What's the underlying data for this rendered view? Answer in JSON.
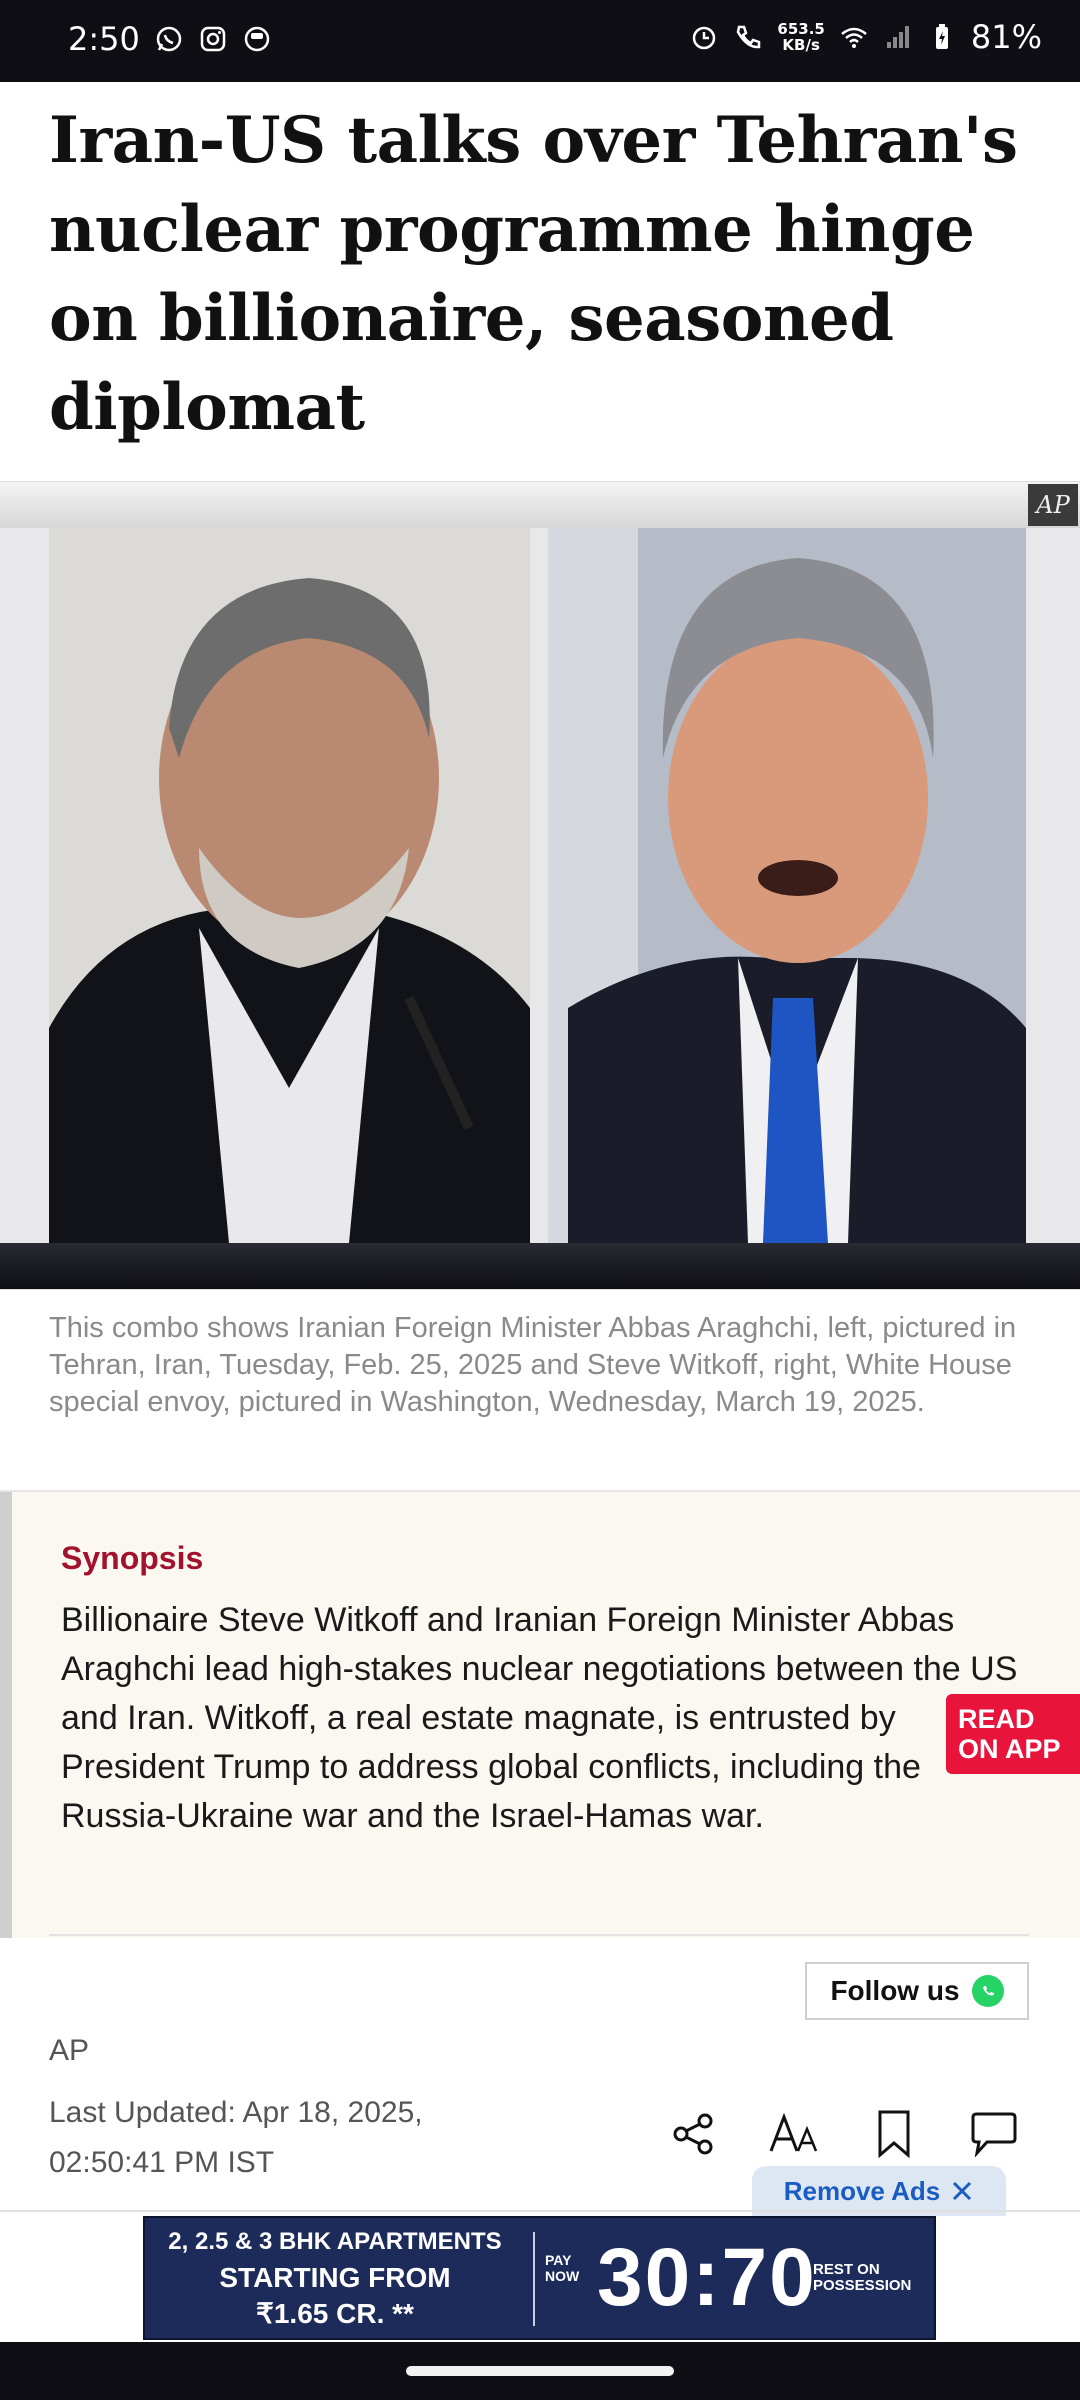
{
  "status_bar": {
    "time": "2:50",
    "speed_value": "653.5",
    "speed_unit": "KB/s",
    "battery": "81%"
  },
  "article": {
    "headline": "Iran-US talks over Tehran's nuclear programme hinge on billionaire, seasoned diplomat",
    "image_credit": "AP",
    "caption": "This combo shows Iranian Foreign Minister Abbas Araghchi, left, pictured in Tehran, Iran, Tuesday, Feb. 25, 2025 and Steve Witkoff, right, White House special envoy, pictured in Washington, Wednesday, March 19, 2025.",
    "synopsis_title": "Synopsis",
    "synopsis_text": "Billionaire Steve Witkoff and Iranian Foreign Minister Abbas Araghchi lead high-stakes nuclear negotiations between the US and Iran. Witkoff, a real estate magnate, is entrusted by President Trump to address global conflicts, including the Russia-Ukraine war and the Israel-Hamas war.",
    "source": "AP",
    "last_updated_line1": "Last Updated: Apr 18, 2025,",
    "last_updated_line2": "02:50:41 PM IST"
  },
  "buttons": {
    "read_on_app_line1": "READ",
    "read_on_app_line2": "ON APP",
    "follow_us": "Follow us",
    "remove_ads": "Remove Ads"
  },
  "ad": {
    "line1": "2, 2.5 & 3 BHK APARTMENTS",
    "line2": "STARTING FROM",
    "line3": "₹1.65 CR. **",
    "pay_now_1": "PAY",
    "pay_now_2": "NOW",
    "ratio": "30:70",
    "rest_1": "REST ON",
    "rest_2": "POSSESSION"
  },
  "icons": [
    "whatsapp-icon",
    "instagram-icon",
    "app-icon",
    "alarm-icon",
    "call-icon",
    "wifi-icon",
    "signal-icon",
    "battery-icon",
    "share-icon",
    "font-size-icon",
    "bookmark-icon",
    "comment-icon",
    "close-icon"
  ],
  "colors": {
    "synopsis_accent": "#a3122c",
    "read_on_app": "#e8143b",
    "whatsapp": "#25d366",
    "remove_ads_text": "#1a5cc2",
    "ad_background": "#1d2b5b"
  }
}
